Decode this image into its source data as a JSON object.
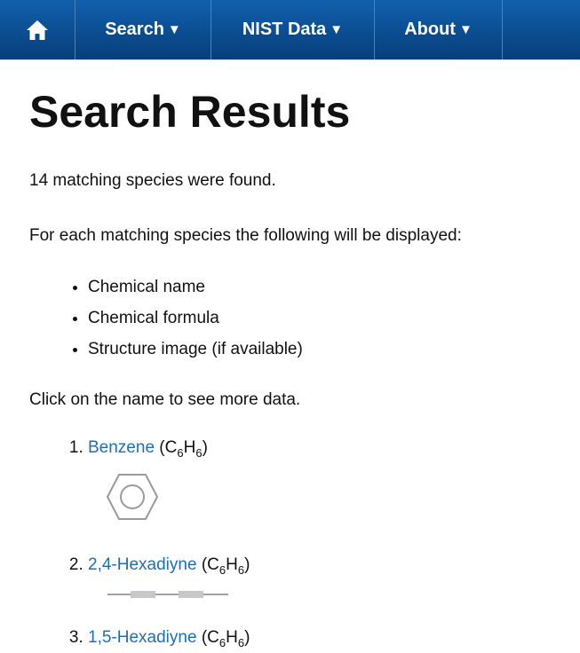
{
  "nav": {
    "home_icon": "house-icon",
    "items": [
      {
        "label": "Search",
        "caret": "▼"
      },
      {
        "label": "NIST Data",
        "caret": "▼"
      },
      {
        "label": "About",
        "caret": "▼"
      }
    ]
  },
  "page": {
    "title": "Search Results",
    "count_text": "14 matching species were found.",
    "intro_text": "For each matching species the following will be displayed:",
    "bullets": [
      "Chemical name",
      "Chemical formula",
      "Structure image (if available)"
    ],
    "click_text": "Click on the name to see more data."
  },
  "results": [
    {
      "name": "Benzene",
      "formula_element1": "C",
      "formula_count1": "6",
      "formula_element2": "H",
      "formula_count2": "6",
      "structure_icon": "benzene-ring-icon"
    },
    {
      "name": "2,4-Hexadiyne",
      "formula_element1": "C",
      "formula_count1": "6",
      "formula_element2": "H",
      "formula_count2": "6",
      "structure_icon": "linear-chain-icon"
    },
    {
      "name": "1,5-Hexadiyne",
      "formula_element1": "C",
      "formula_count1": "6",
      "formula_element2": "H",
      "formula_count2": "6"
    }
  ],
  "colors": {
    "nav_bg": "#0b4f95",
    "link": "#1d6fb3"
  }
}
